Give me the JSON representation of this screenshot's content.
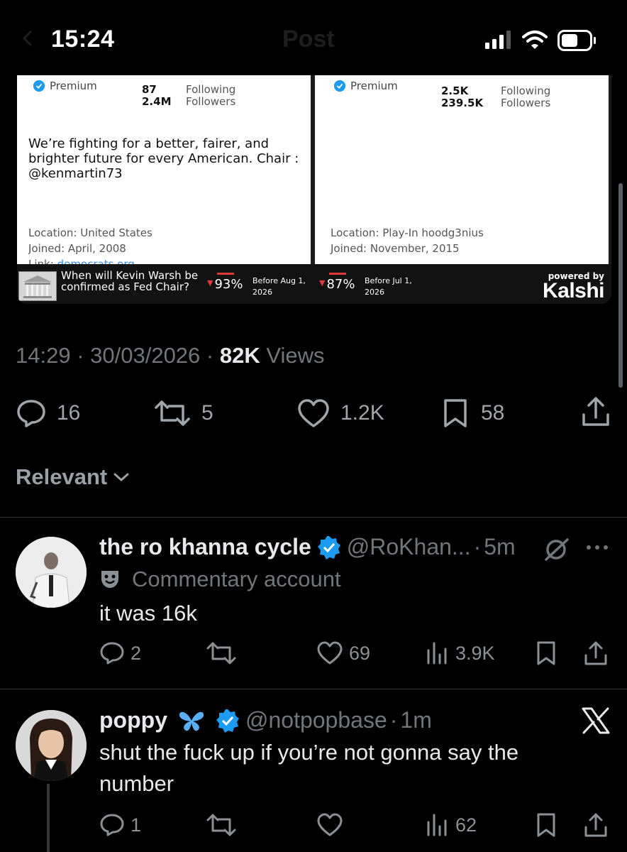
{
  "status_bar": {
    "time": "15:24",
    "ghost_title": "Post"
  },
  "embed": {
    "card_left": {
      "badge": "Premium",
      "following_count": "87",
      "following_label": "Following",
      "followers_count": "2.4M",
      "followers_label": "Followers",
      "bio": "We’re fighting for a better, fairer, and brighter future for every American. Chair : @kenmartin73",
      "location": "Location: United States",
      "joined": "Joined: April, 2008",
      "link_label": "Link:",
      "link": "democrats.org"
    },
    "card_right": {
      "badge": "Premium",
      "following_count": "2.5K",
      "following_label": "Following",
      "followers_count": "239.5K",
      "followers_label": "Followers",
      "location": "Location: Play-In hoodg3nius",
      "joined": "Joined: November, 2015"
    },
    "kalshi": {
      "question": "When will Kevin Warsh be confirmed as Fed Chair?",
      "opt1_pct": "93%",
      "opt1_date": "Before Aug 1, 2026",
      "opt2_pct": "87%",
      "opt2_date": "Before Jul 1, 2026",
      "powered_by": "powered by",
      "brand": "Kalshi"
    }
  },
  "post": {
    "time": "14:29",
    "date": "30/03/2026",
    "views_count": "82K",
    "views_label": "Views",
    "replies": "16",
    "reposts": "5",
    "likes": "1.2K",
    "bookmarks": "58"
  },
  "sort": {
    "label": "Relevant"
  },
  "replies": [
    {
      "name": "the ro khanna cycle",
      "handle": "@RoKhan...",
      "time": "5m",
      "label": "Commentary account",
      "text": "it was 16k",
      "replies": "2",
      "reposts": "",
      "likes": "69",
      "views": "3.9K"
    },
    {
      "name": "poppy",
      "handle": "@notpopbase",
      "time": "1m",
      "text_line1": "shut the fuck up if you’re not gonna say the",
      "text_line2": "number",
      "replies": "1",
      "reposts": "",
      "likes": "",
      "views": "62"
    }
  ],
  "colors": {
    "verified": "#1d9bf0",
    "background": "#000000",
    "kalshi_red": "#e0393b"
  }
}
